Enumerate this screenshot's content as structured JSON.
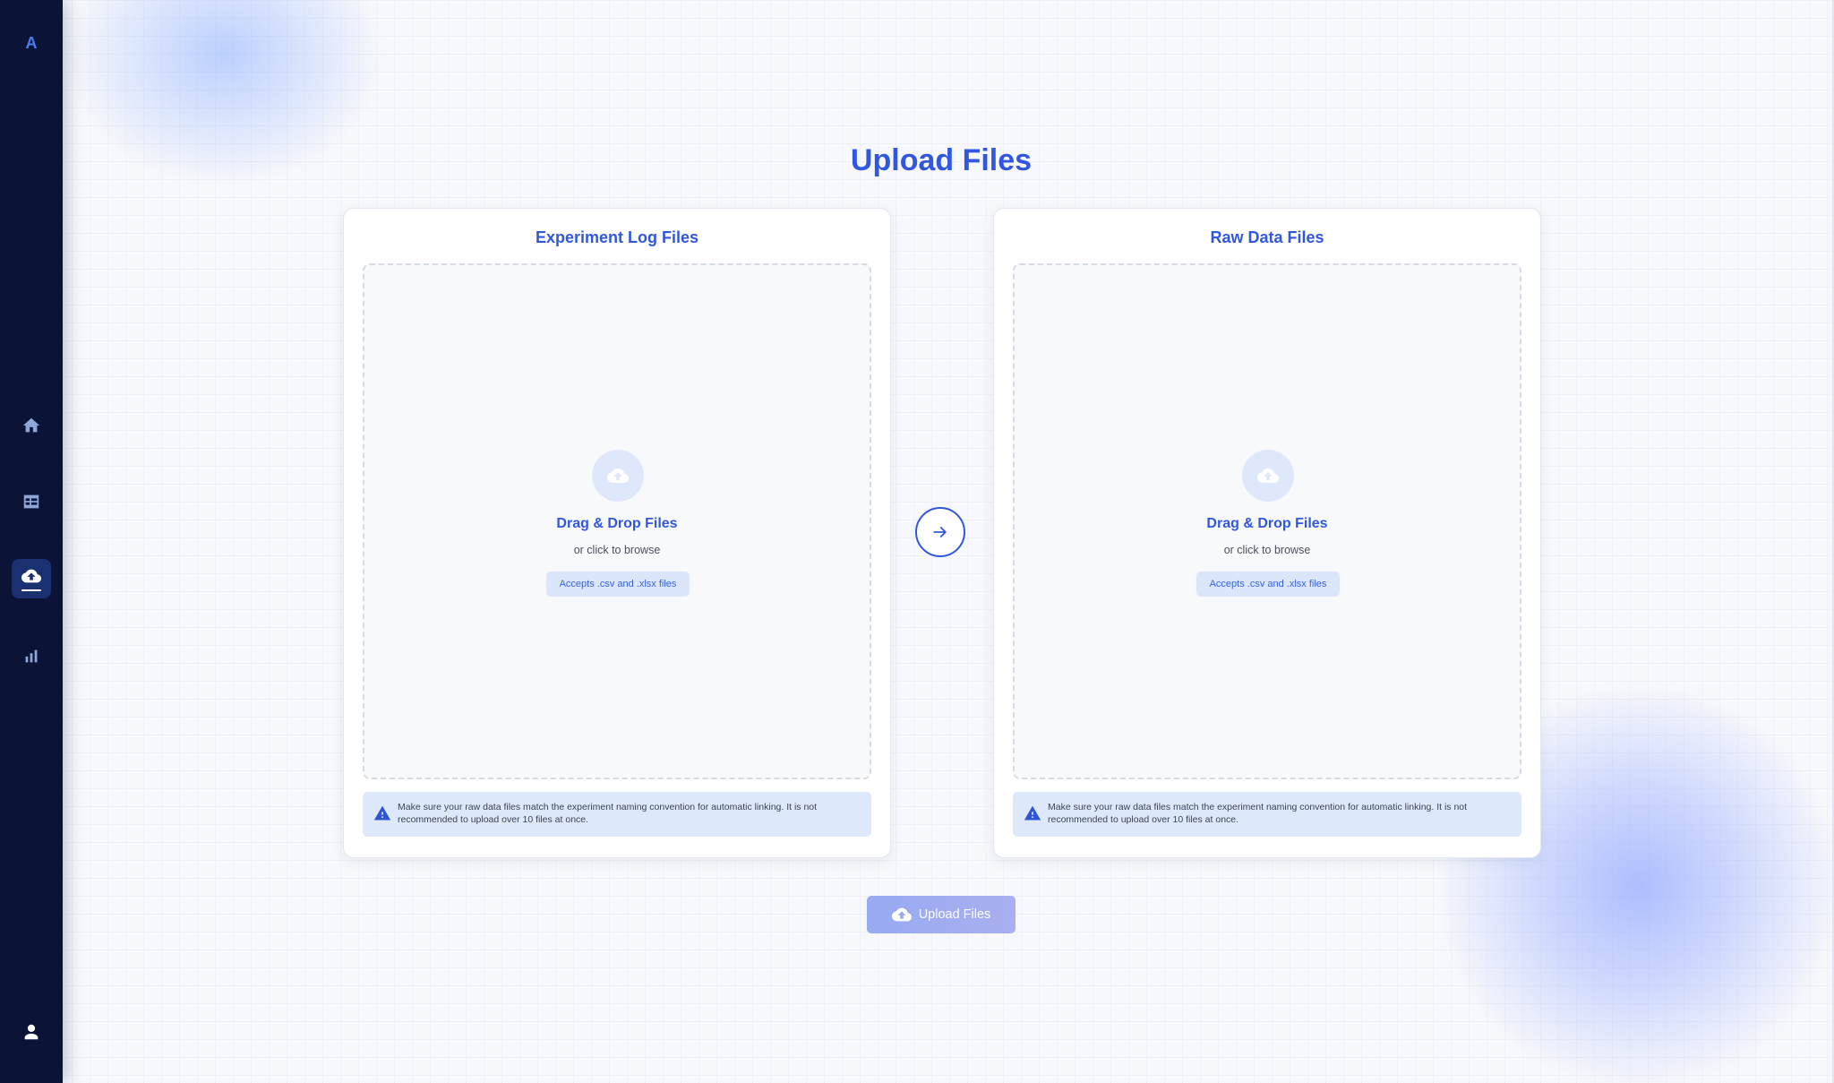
{
  "app": {
    "logo_letter": "A",
    "accent_color": "#3157e0",
    "sidebar_color": "#0b1437"
  },
  "sidebar": {
    "items": [
      {
        "name": "home",
        "icon": "home-icon",
        "active": false
      },
      {
        "name": "table",
        "icon": "table-icon",
        "active": false
      },
      {
        "name": "upload",
        "icon": "cloud-upload-icon",
        "active": true
      },
      {
        "name": "analytics",
        "icon": "bar-chart-icon",
        "active": false
      }
    ],
    "user_icon": "user-icon"
  },
  "page": {
    "title": "Upload Files"
  },
  "cards": [
    {
      "title": "Experiment Log Files",
      "dropzone": {
        "icon": "cloud-upload-icon",
        "title": "Drag & Drop Files",
        "subtitle": "or click to browse",
        "accepts": "Accepts .csv and .xlsx files"
      },
      "notice": {
        "icon": "warning-icon",
        "text": "Make sure your raw data files match the experiment naming convention for automatic linking. It is not recommended to upload over 10 files at once."
      }
    },
    {
      "title": "Raw Data Files",
      "dropzone": {
        "icon": "cloud-upload-icon",
        "title": "Drag & Drop Files",
        "subtitle": "or click to browse",
        "accepts": "Accepts .csv and .xlsx files"
      },
      "notice": {
        "icon": "warning-icon",
        "text": "Make sure your raw data files match the experiment naming convention for automatic linking. It is not recommended to upload over 10 files at once."
      }
    }
  ],
  "arrow": {
    "icon": "arrow-right-icon"
  },
  "upload_button": {
    "label": "Upload Files",
    "icon": "cloud-upload-icon",
    "disabled": true
  }
}
